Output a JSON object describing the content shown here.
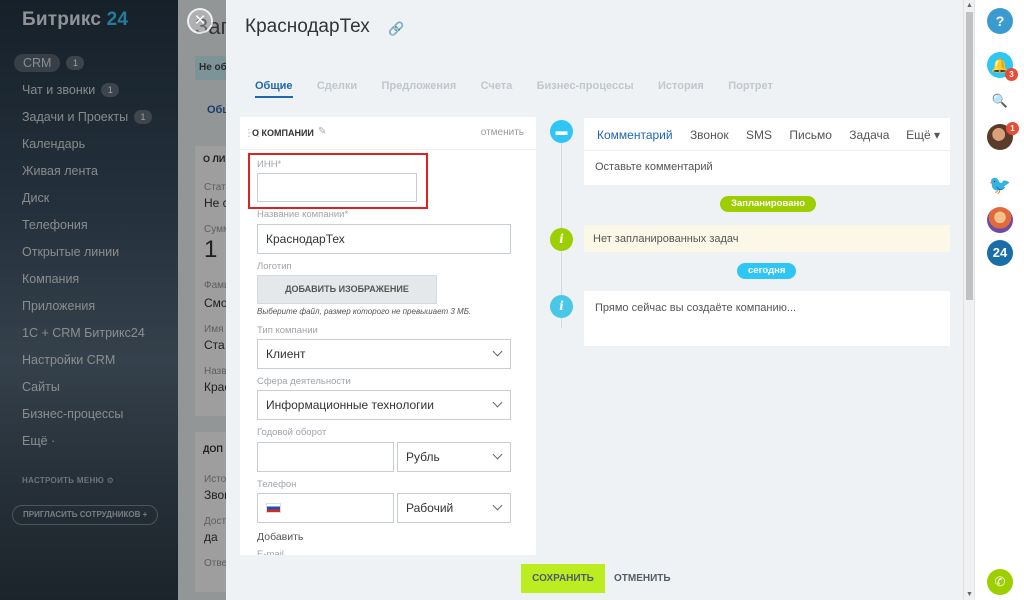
{
  "sidebar": {
    "logo_text": "Битрикс",
    "logo_num": "24",
    "items": [
      {
        "label": "CRM",
        "badge": "1"
      },
      {
        "label": "Чат и звонки",
        "badge": "1"
      },
      {
        "label": "Задачи и Проекты",
        "badge": "1"
      },
      {
        "label": "Календарь"
      },
      {
        "label": "Живая лента"
      },
      {
        "label": "Диск"
      },
      {
        "label": "Телефония"
      },
      {
        "label": "Открытые линии"
      },
      {
        "label": "Компания"
      },
      {
        "label": "Приложения"
      },
      {
        "label": "1С + CRM Битрикс24"
      },
      {
        "label": "Настройки CRM"
      },
      {
        "label": "Сайты"
      },
      {
        "label": "Бизнес-процессы"
      },
      {
        "label": "Ещё ·"
      }
    ],
    "setup_menu": "НАСТРОИТЬ МЕНЮ ⚙",
    "invite": "ПРИГЛАСИТЬ СОТРУДНИКОВ +"
  },
  "background_page": {
    "title": "Заг",
    "tip": "Не об",
    "tab": "Общ",
    "section1": "О ЛИ",
    "labels": [
      "Стат",
      "Сумм",
      "Фами",
      "Имя",
      "Назв"
    ],
    "values": [
      "Не с",
      "1",
      "Смо",
      "Ста",
      "Крас"
    ],
    "section2": "ДОП",
    "labels2": [
      "Исто",
      "Дост",
      "Отве"
    ],
    "values2": [
      "Звон",
      "да"
    ]
  },
  "panel": {
    "close_label": "×",
    "title": "КраснодарТех",
    "tabs": [
      {
        "label": "Общие",
        "active": true
      },
      {
        "label": "Сделки"
      },
      {
        "label": "Предложения"
      },
      {
        "label": "Счета"
      },
      {
        "label": "Бизнес-процессы"
      },
      {
        "label": "История"
      },
      {
        "label": "Портрет"
      }
    ]
  },
  "form": {
    "section_title": "О КОМПАНИИ",
    "cancel_link": "отменить",
    "inn_label": "ИНН*",
    "inn_value": "",
    "name_label": "Название компании*",
    "name_value": "КраснодарТех",
    "logo_label": "Логотип",
    "add_image_button": "ДОБАВИТЬ ИЗОБРАЖЕНИЕ",
    "file_hint": "Выберите файл, размер которого не превышает 3 МБ.",
    "type_label": "Тип компании",
    "type_value": "Клиент",
    "industry_label": "Сфера деятельности",
    "industry_value": "Информационные технологии",
    "revenue_label": "Годовой оборот",
    "revenue_value": "",
    "currency_value": "Рубль",
    "phone_label": "Телефон",
    "phone_value": "",
    "phone_type_value": "Рабочий",
    "add_link": "Добавить",
    "email_label": "E-mail"
  },
  "timeline": {
    "tabs": [
      {
        "label": "Комментарий",
        "active": true
      },
      {
        "label": "Звонок"
      },
      {
        "label": "SMS"
      },
      {
        "label": "Письмо"
      },
      {
        "label": "Задача"
      }
    ],
    "more": "Ещё ▾",
    "comment_placeholder": "Оставьте комментарий",
    "planned_badge": "Запланировано",
    "no_tasks": "Нет запланированных задач",
    "today_badge": "сегодня",
    "creating_text": "Прямо сейчас вы создаёте компанию..."
  },
  "footer": {
    "save_label": "СОХРАНИТЬ",
    "cancel_label": "ОТМЕНИТЬ"
  },
  "rightbar": {
    "help": "?",
    "bell_count": "3",
    "avatar_count": "1",
    "b24": "24"
  },
  "colors": {
    "accent_blue": "#2067b0",
    "save_green": "#bbed21",
    "timeline_green": "#9dcf00",
    "timeline_blue": "#2fc6f6",
    "highlight_red": "#dd2222"
  }
}
